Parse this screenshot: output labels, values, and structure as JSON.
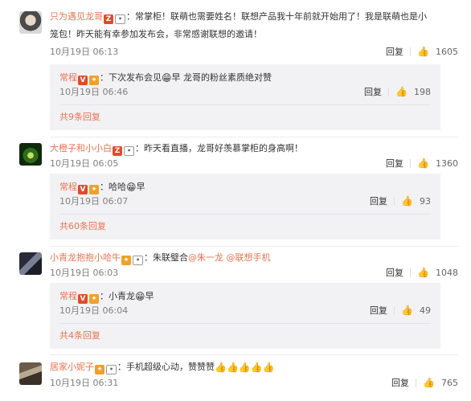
{
  "comments": [
    {
      "user": "只为遇见龙哥",
      "text_line1": "：常掌柜！联萌也需要姓名！联想产品我十年前就开始用了！我是联萌也是小",
      "text_line2": "笼包！昨天能有幸参加发布会，非常感谢联想的邀请！",
      "time": "10月19日 06:13",
      "reply_label": "回复",
      "likes": "1605",
      "sub": {
        "user": "常程",
        "text": "：下次发布会见",
        "text_tail": "早 龙哥的粉丝素质绝对赞",
        "time": "10月19日 06:46",
        "reply_label": "回复",
        "likes": "198",
        "more": "共9条回复"
      }
    },
    {
      "user": "大橙子和小小白",
      "text": "：昨天看直播，龙哥好羡慕掌柜的身高啊！",
      "time": "10月19日 06:05",
      "reply_label": "回复",
      "likes": "1360",
      "sub": {
        "user": "常程",
        "text": "：哈哈",
        "text_tail": "早",
        "time": "10月19日 06:07",
        "reply_label": "回复",
        "likes": "93",
        "more": "共60条回复"
      }
    },
    {
      "user": "小青龙抱抱小哈牛",
      "text": "：朱联璧合",
      "mention1": "@朱一龙",
      "mention2": "@联想手机",
      "time": "10月19日 06:03",
      "reply_label": "回复",
      "likes": "1048",
      "sub": {
        "user": "常程",
        "text": "：小青龙",
        "text_tail": "早",
        "time": "10月19日 06:04",
        "reply_label": "回复",
        "likes": "49",
        "more": "共4条回复"
      }
    },
    {
      "user": "居家小妮子",
      "text": "：手机超级心动，赞赞赞",
      "thumbs": "👍👍👍👍👍",
      "time": "10月19日 06:31",
      "reply_label": "回复",
      "likes": "765"
    }
  ],
  "icons": {
    "like": "like-icon",
    "vip": "vip-badge-icon",
    "fan": "fan-badge-icon",
    "emoji": "grin-emoji-icon"
  }
}
